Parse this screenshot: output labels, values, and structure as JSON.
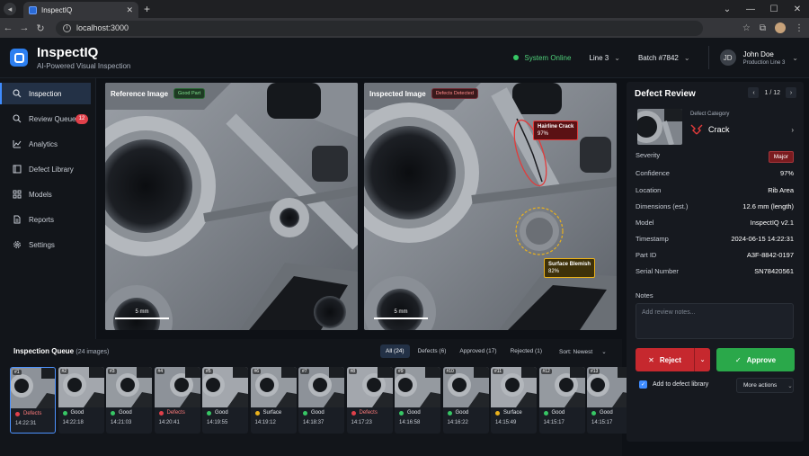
{
  "browser": {
    "tab_title": "InspectIQ",
    "url": "localhost:3000"
  },
  "app": {
    "name": "InspectIQ",
    "tagline": "AI-Powered Visual Inspection",
    "status": "System Online",
    "line": "Line 3",
    "batch": "Batch #7842",
    "user_name": "John Doe",
    "user_role": "Production Line 3",
    "user_initials": "JD"
  },
  "sidebar": {
    "items": [
      {
        "label": "Inspection",
        "icon": "search-icon",
        "active": true
      },
      {
        "label": "Review Queue",
        "icon": "review-icon",
        "badge": "12"
      },
      {
        "label": "Analytics",
        "icon": "chart-icon"
      },
      {
        "label": "Defect Library",
        "icon": "library-icon"
      },
      {
        "label": "Models",
        "icon": "models-icon"
      },
      {
        "label": "Reports",
        "icon": "report-icon"
      },
      {
        "label": "Settings",
        "icon": "gear-icon"
      }
    ]
  },
  "reference": {
    "title": "Reference Image",
    "chip": "Good Part",
    "scale": "5 mm"
  },
  "inspected": {
    "title": "Inspected Image",
    "chip": "Defects Detected",
    "scale": "5 mm",
    "annotations": [
      {
        "label": "Hairline Crack",
        "conf": "97%",
        "color": "#e23b3b"
      },
      {
        "label": "Surface Blemish",
        "conf": "82%",
        "color": "#e9b11c"
      }
    ]
  },
  "queue": {
    "title": "Inspection Queue",
    "count": "(24 images)",
    "filters": [
      "All (24)",
      "Defects (6)",
      "Approved (17)",
      "Rejected (1)"
    ],
    "sort": "Sort: Newest",
    "items": [
      {
        "no": "#1",
        "status": "Defects",
        "color": "#e0404a",
        "time": "14:22:31"
      },
      {
        "no": "#2",
        "status": "Good",
        "color": "#37c765",
        "time": "14:22:18"
      },
      {
        "no": "#3",
        "status": "Good",
        "color": "#37c765",
        "time": "14:21:03"
      },
      {
        "no": "#4",
        "status": "Defects",
        "color": "#e0404a",
        "time": "14:20:41"
      },
      {
        "no": "#5",
        "status": "Good",
        "color": "#37c765",
        "time": "14:19:55"
      },
      {
        "no": "#6",
        "status": "Surface",
        "color": "#e9b11c",
        "time": "14:19:12"
      },
      {
        "no": "#7",
        "status": "Good",
        "color": "#37c765",
        "time": "14:18:37"
      },
      {
        "no": "#8",
        "status": "Defects",
        "color": "#e0404a",
        "time": "14:17:23"
      },
      {
        "no": "#9",
        "status": "Good",
        "color": "#37c765",
        "time": "14:16:58"
      },
      {
        "no": "#10",
        "status": "Good",
        "color": "#37c765",
        "time": "14:16:22"
      },
      {
        "no": "#11",
        "status": "Surface",
        "color": "#e9b11c",
        "time": "14:15:49"
      },
      {
        "no": "#12",
        "status": "Good",
        "color": "#37c765",
        "time": "14:15:17"
      },
      {
        "no": "#13",
        "status": "Good",
        "color": "#37c765",
        "time": "14:15:17"
      }
    ]
  },
  "review": {
    "title": "Defect Review",
    "pager": "1 / 12",
    "category_label": "Defect Category",
    "category": "Crack",
    "fields": [
      {
        "k": "Severity",
        "v": "Major"
      },
      {
        "k": "Confidence",
        "v": "97%"
      },
      {
        "k": "Location",
        "v": "Rib Area"
      },
      {
        "k": "Dimensions (est.)",
        "v": "12.6 mm (length)"
      },
      {
        "k": "Model",
        "v": "InspectIQ v2.1"
      },
      {
        "k": "Timestamp",
        "v": "2024-06-15 14:22:31"
      },
      {
        "k": "Part ID",
        "v": "A3F-8842-0197"
      },
      {
        "k": "Serial Number",
        "v": "SN78420561"
      }
    ],
    "notes_label": "Notes",
    "notes_placeholder": "Add review notes...",
    "reject": "Reject",
    "approve": "Approve",
    "add_library": "Add to defect library",
    "more_actions": "More actions"
  }
}
